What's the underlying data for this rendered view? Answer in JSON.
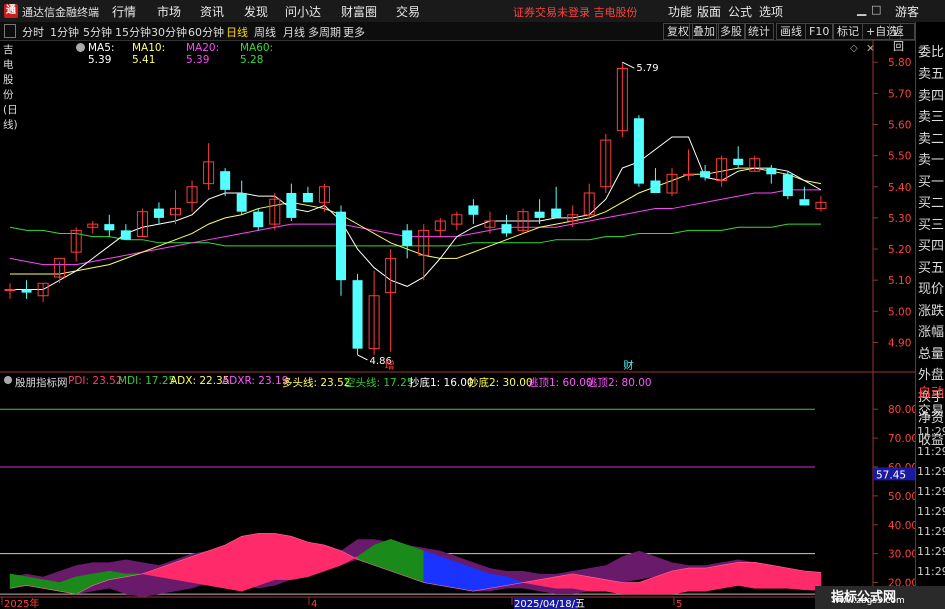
{
  "window": {
    "title": "通达信金融终端",
    "status": "证券交易未登录 吉电股份"
  },
  "menu": [
    "行情",
    "市场",
    "资讯",
    "发现",
    "问小达",
    "财富圈",
    "交易"
  ],
  "menu_right": [
    "功能",
    "版面",
    "公式",
    "选项",
    "游客"
  ],
  "period_tabs": [
    "分时",
    "1分钟",
    "5分钟",
    "15分钟",
    "30分钟",
    "60分钟",
    "日线",
    "周线",
    "月线",
    "多周期",
    "更多"
  ],
  "active_period": "日线",
  "toolbar_right": [
    "复权",
    "叠加",
    "多股",
    "统计",
    "画线",
    "F10",
    "标记",
    "+自选",
    "返回"
  ],
  "info": {
    "stock": "吉电股份(日线)",
    "ma5": "MA5: 5.39",
    "ma10": "MA10: 5.41",
    "ma20": "MA20: 5.39",
    "ma60": "MA60: 5.28"
  },
  "price_axis": [
    "5.80",
    "5.70",
    "5.60",
    "5.50",
    "5.40",
    "5.30",
    "5.20",
    "5.10",
    "5.00",
    "4.90"
  ],
  "annotations": {
    "high": "5.79",
    "low": "4.86",
    "marker_zeng": "增",
    "marker_cai": "财"
  },
  "indicator": {
    "name": "殷朋指标网",
    "pdi": "PDI: 23.52",
    "mdi": "MDI: 17.25",
    "adx": "ADX: 22.35",
    "adxr": "ADXR: 23.19",
    "dtx": "多头线: 23.52",
    "ktx": "空头线: 17.25",
    "cd1": "抄底1: 16.00",
    "cd2": "抄底2: 30.00",
    "td1": "逃顶1: 60.00",
    "td2": "逃顶2: 80.00"
  },
  "indicator_axis": [
    "80.00",
    "70.00",
    "60.00",
    "50.00",
    "40.00",
    "30.00",
    "20.00"
  ],
  "indicator_value_badge": "57.45",
  "date_axis": [
    "2025年",
    "4",
    "2025/04/18/五",
    "5"
  ],
  "right_panel": {
    "top": "委比",
    "items": [
      "卖五",
      "卖四",
      "卖三",
      "卖二",
      "卖一",
      "买一",
      "买二",
      "买三",
      "买四",
      "买五",
      "现价",
      "涨跌",
      "涨幅",
      "总量",
      "外盘",
      "换手",
      "净资",
      "收益"
    ],
    "lower": [
      "自动",
      "交易"
    ],
    "times": [
      "11:29",
      "11:29",
      "11:29",
      "11:29",
      "11:29",
      "11:29",
      "11:29",
      "11:29",
      "11:29"
    ],
    "badge": "R\n1000"
  },
  "watermark": {
    "line1": "指标公式网",
    "line2": "www.zbgs3.com"
  },
  "colors": {
    "up": "#ff3c3c",
    "down": "#54ffff",
    "ma5": "#ffffff",
    "ma10": "#ffff66",
    "ma20": "#ff44ff",
    "ma60": "#33dd33",
    "pdi": "#ff3c6e",
    "mdi": "#33cc33",
    "adx": "#ffff55",
    "adxr": "#ff55ff"
  },
  "chart_data": [
    {
      "type": "candlestick",
      "title": "吉电股份(日线)",
      "ylim": [
        4.85,
        5.82
      ],
      "candles": [
        {
          "o": 5.07,
          "h": 5.09,
          "l": 5.04,
          "c": 5.07
        },
        {
          "o": 5.07,
          "h": 5.1,
          "l": 5.04,
          "c": 5.06
        },
        {
          "o": 5.05,
          "h": 5.09,
          "l": 5.03,
          "c": 5.09
        },
        {
          "o": 5.11,
          "h": 5.16,
          "l": 5.09,
          "c": 5.17
        },
        {
          "o": 5.19,
          "h": 5.27,
          "l": 5.16,
          "c": 5.26
        },
        {
          "o": 5.27,
          "h": 5.29,
          "l": 5.25,
          "c": 5.28
        },
        {
          "o": 5.28,
          "h": 5.31,
          "l": 5.24,
          "c": 5.26
        },
        {
          "o": 5.26,
          "h": 5.28,
          "l": 5.23,
          "c": 5.23
        },
        {
          "o": 5.24,
          "h": 5.33,
          "l": 5.24,
          "c": 5.32
        },
        {
          "o": 5.33,
          "h": 5.35,
          "l": 5.28,
          "c": 5.3
        },
        {
          "o": 5.31,
          "h": 5.39,
          "l": 5.28,
          "c": 5.33
        },
        {
          "o": 5.35,
          "h": 5.42,
          "l": 5.32,
          "c": 5.4
        },
        {
          "o": 5.41,
          "h": 5.54,
          "l": 5.39,
          "c": 5.48
        },
        {
          "o": 5.45,
          "h": 5.46,
          "l": 5.37,
          "c": 5.39
        },
        {
          "o": 5.38,
          "h": 5.42,
          "l": 5.31,
          "c": 5.32
        },
        {
          "o": 5.32,
          "h": 5.33,
          "l": 5.26,
          "c": 5.27
        },
        {
          "o": 5.28,
          "h": 5.38,
          "l": 5.26,
          "c": 5.36
        },
        {
          "o": 5.38,
          "h": 5.41,
          "l": 5.29,
          "c": 5.3
        },
        {
          "o": 5.38,
          "h": 5.4,
          "l": 5.35,
          "c": 5.35
        },
        {
          "o": 5.35,
          "h": 5.41,
          "l": 5.32,
          "c": 5.4
        },
        {
          "o": 5.32,
          "h": 5.34,
          "l": 5.05,
          "c": 5.1
        },
        {
          "o": 5.1,
          "h": 5.12,
          "l": 4.86,
          "c": 4.88
        },
        {
          "o": 4.88,
          "h": 5.13,
          "l": 4.86,
          "c": 5.05
        },
        {
          "o": 5.06,
          "h": 5.2,
          "l": 4.87,
          "c": 5.17
        },
        {
          "o": 5.26,
          "h": 5.28,
          "l": 5.17,
          "c": 5.21
        },
        {
          "o": 5.18,
          "h": 5.28,
          "l": 5.1,
          "c": 5.26
        },
        {
          "o": 5.26,
          "h": 5.3,
          "l": 5.24,
          "c": 5.29
        },
        {
          "o": 5.28,
          "h": 5.32,
          "l": 5.26,
          "c": 5.31
        },
        {
          "o": 5.34,
          "h": 5.36,
          "l": 5.28,
          "c": 5.31
        },
        {
          "o": 5.27,
          "h": 5.32,
          "l": 5.25,
          "c": 5.29
        },
        {
          "o": 5.28,
          "h": 5.31,
          "l": 5.24,
          "c": 5.25
        },
        {
          "o": 5.26,
          "h": 5.33,
          "l": 5.25,
          "c": 5.32
        },
        {
          "o": 5.32,
          "h": 5.36,
          "l": 5.28,
          "c": 5.3
        },
        {
          "o": 5.33,
          "h": 5.4,
          "l": 5.3,
          "c": 5.3
        },
        {
          "o": 5.29,
          "h": 5.34,
          "l": 5.27,
          "c": 5.31
        },
        {
          "o": 5.31,
          "h": 5.41,
          "l": 5.3,
          "c": 5.38
        },
        {
          "o": 5.4,
          "h": 5.57,
          "l": 5.38,
          "c": 5.55
        },
        {
          "o": 5.58,
          "h": 5.8,
          "l": 5.56,
          "c": 5.78
        },
        {
          "o": 5.62,
          "h": 5.63,
          "l": 5.4,
          "c": 5.41
        },
        {
          "o": 5.42,
          "h": 5.46,
          "l": 5.38,
          "c": 5.38
        },
        {
          "o": 5.38,
          "h": 5.46,
          "l": 5.37,
          "c": 5.44
        },
        {
          "o": 5.44,
          "h": 5.52,
          "l": 5.42,
          "c": 5.44
        },
        {
          "o": 5.45,
          "h": 5.47,
          "l": 5.42,
          "c": 5.43
        },
        {
          "o": 5.42,
          "h": 5.5,
          "l": 5.4,
          "c": 5.49
        },
        {
          "o": 5.49,
          "h": 5.53,
          "l": 5.46,
          "c": 5.47
        },
        {
          "o": 5.45,
          "h": 5.5,
          "l": 5.45,
          "c": 5.49
        },
        {
          "o": 5.46,
          "h": 5.47,
          "l": 5.41,
          "c": 5.44
        },
        {
          "o": 5.44,
          "h": 5.45,
          "l": 5.36,
          "c": 5.37
        },
        {
          "o": 5.36,
          "h": 5.4,
          "l": 5.34,
          "c": 5.34
        },
        {
          "o": 5.33,
          "h": 5.37,
          "l": 5.32,
          "c": 5.35
        }
      ],
      "ma5": [
        5.07,
        5.07,
        5.07,
        5.1,
        5.13,
        5.17,
        5.21,
        5.25,
        5.27,
        5.28,
        5.29,
        5.31,
        5.36,
        5.38,
        5.38,
        5.37,
        5.37,
        5.33,
        5.32,
        5.34,
        5.29,
        5.2,
        5.14,
        5.1,
        5.08,
        5.11,
        5.17,
        5.24,
        5.27,
        5.29,
        5.29,
        5.29,
        5.29,
        5.3,
        5.3,
        5.31,
        5.36,
        5.46,
        5.48,
        5.52,
        5.56,
        5.56,
        5.43,
        5.42,
        5.45,
        5.46,
        5.46,
        5.45,
        5.42,
        5.39
      ],
      "ma10": [
        5.12,
        5.12,
        5.12,
        5.12,
        5.13,
        5.14,
        5.15,
        5.17,
        5.19,
        5.21,
        5.23,
        5.25,
        5.28,
        5.3,
        5.31,
        5.33,
        5.34,
        5.35,
        5.34,
        5.33,
        5.31,
        5.28,
        5.25,
        5.22,
        5.2,
        5.18,
        5.17,
        5.17,
        5.19,
        5.21,
        5.23,
        5.25,
        5.27,
        5.28,
        5.29,
        5.3,
        5.32,
        5.35,
        5.38,
        5.4,
        5.42,
        5.44,
        5.44,
        5.45,
        5.46,
        5.46,
        5.45,
        5.44,
        5.42,
        5.41
      ],
      "ma20": [
        5.17,
        5.16,
        5.15,
        5.15,
        5.15,
        5.16,
        5.17,
        5.18,
        5.19,
        5.2,
        5.21,
        5.22,
        5.23,
        5.24,
        5.25,
        5.26,
        5.27,
        5.28,
        5.28,
        5.28,
        5.28,
        5.27,
        5.26,
        5.25,
        5.24,
        5.24,
        5.24,
        5.24,
        5.25,
        5.26,
        5.27,
        5.27,
        5.27,
        5.27,
        5.28,
        5.29,
        5.3,
        5.31,
        5.32,
        5.33,
        5.33,
        5.34,
        5.35,
        5.36,
        5.37,
        5.38,
        5.38,
        5.39,
        5.39,
        5.39
      ],
      "ma60": [
        5.27,
        5.26,
        5.26,
        5.25,
        5.25,
        5.24,
        5.24,
        5.23,
        5.23,
        5.22,
        5.22,
        5.22,
        5.22,
        5.21,
        5.21,
        5.21,
        5.21,
        5.21,
        5.21,
        5.21,
        5.21,
        5.21,
        5.21,
        5.21,
        5.21,
        5.21,
        5.21,
        5.21,
        5.22,
        5.22,
        5.22,
        5.22,
        5.22,
        5.23,
        5.23,
        5.23,
        5.24,
        5.24,
        5.25,
        5.25,
        5.25,
        5.26,
        5.26,
        5.26,
        5.27,
        5.27,
        5.27,
        5.28,
        5.28,
        5.28
      ]
    },
    {
      "type": "line",
      "title": "殷朋指标网",
      "ylim": [
        15,
        87
      ],
      "reference_lines": {
        "cd1": 16,
        "cd2": 30,
        "td1": 60,
        "td2": 80
      },
      "pdi": [
        18,
        19,
        18,
        17,
        16,
        19,
        21,
        22,
        23,
        25,
        27,
        29,
        31,
        33,
        36,
        37,
        37,
        36,
        34,
        33,
        31,
        28,
        26,
        24,
        22,
        20,
        19,
        18,
        17,
        18,
        19,
        20,
        21,
        22,
        23,
        22,
        21,
        20,
        20,
        22,
        24,
        25,
        25,
        26,
        27,
        27,
        26,
        25,
        24,
        23.5
      ],
      "mdi": [
        23,
        22,
        21,
        20,
        22,
        23,
        24,
        23,
        23,
        22,
        21,
        20,
        19,
        18,
        17,
        19,
        21,
        21,
        22,
        24,
        26,
        29,
        33,
        35,
        33,
        31,
        29,
        27,
        25,
        23,
        22,
        20,
        19,
        18,
        18,
        17,
        17,
        16,
        16,
        16,
        16,
        17,
        17,
        18,
        19,
        18,
        18,
        18,
        17.5,
        17.25
      ],
      "adx": [
        30,
        30,
        30,
        30,
        30,
        30,
        30,
        30,
        30,
        30,
        30,
        30,
        30,
        30,
        30,
        30,
        30,
        30,
        30,
        30,
        30,
        30,
        30,
        30,
        30,
        30,
        30,
        30,
        30,
        30,
        30,
        30,
        30,
        30,
        30,
        30,
        30,
        30,
        30,
        30,
        30,
        30,
        30,
        30,
        30,
        30,
        30,
        30,
        30,
        30
      ],
      "adxr": [
        16,
        16,
        16,
        16,
        16,
        16,
        16,
        16,
        16,
        16,
        16,
        16,
        16,
        16,
        16,
        16,
        16,
        16,
        16,
        16,
        16,
        16,
        16,
        16,
        16,
        16,
        16,
        16,
        16,
        16,
        16,
        16,
        16,
        16,
        16,
        16,
        16,
        16,
        16,
        16,
        16,
        16,
        16,
        16,
        16,
        16,
        16,
        16,
        16,
        16
      ],
      "band_top": [
        22,
        23,
        22,
        24,
        26,
        27,
        27,
        28,
        27,
        26,
        28,
        30,
        31,
        33,
        35,
        37,
        37,
        36,
        34,
        32,
        31,
        35,
        35,
        34,
        33,
        32,
        31,
        29,
        27,
        25,
        24,
        24,
        23,
        23,
        24,
        25,
        26,
        29,
        31,
        29,
        27,
        26,
        26,
        27,
        28,
        27,
        26,
        25,
        24,
        23.5
      ],
      "band_bottom": [
        18,
        19,
        18,
        17,
        16,
        17,
        18,
        16,
        15,
        16,
        17,
        18,
        20,
        21,
        19,
        18,
        19,
        21,
        22,
        24,
        26,
        28,
        26,
        24,
        22,
        20,
        19,
        18,
        17,
        17,
        18,
        18,
        17,
        16,
        16,
        17,
        18,
        20,
        21,
        22,
        23,
        22,
        21,
        21,
        21,
        20,
        20,
        20,
        19,
        18
      ]
    }
  ]
}
